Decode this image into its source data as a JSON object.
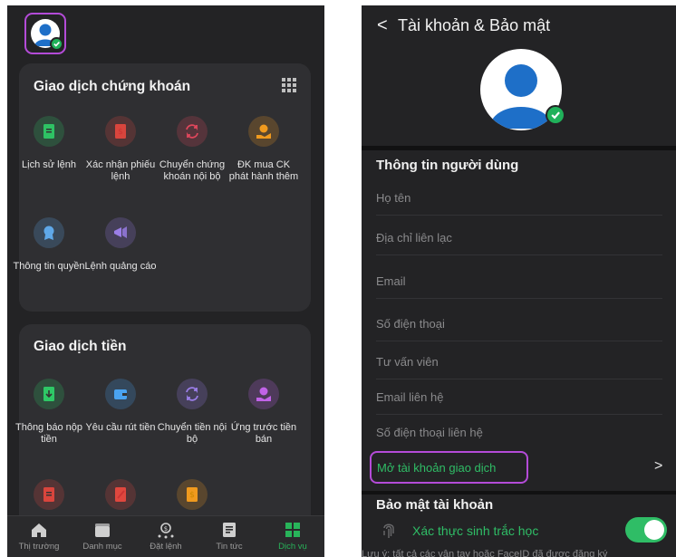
{
  "left": {
    "stock_section": {
      "title": "Giao dịch chứng khoán",
      "items": [
        {
          "label": "Lịch sử lệnh",
          "icon": "document-icon",
          "color": "#2ec866"
        },
        {
          "label": "Xác nhận phiếu lệnh",
          "icon": "receipt-icon",
          "color": "#e0473e"
        },
        {
          "label": "Chuyển chứng khoán nội bộ",
          "icon": "transfer-icon",
          "color": "#e0475c"
        },
        {
          "label": "ĐK mua CK phát hành thêm",
          "icon": "coin-hand-icon",
          "color": "#f09a1e"
        },
        {
          "label": "Thông tin quyền",
          "icon": "badge-icon",
          "color": "#5fa8e8"
        },
        {
          "label": "Lệnh quảng cáo",
          "icon": "megaphone-icon",
          "color": "#9b7ee8"
        }
      ]
    },
    "cash_section": {
      "title": "Giao dịch tiền",
      "items": [
        {
          "label": "Thông báo nộp tiền",
          "icon": "deposit-icon",
          "color": "#2ec866"
        },
        {
          "label": "Yêu cầu rút tiền",
          "icon": "wallet-icon",
          "color": "#4aa3f0"
        },
        {
          "label": "Chuyển tiền nội bộ",
          "icon": "transfer-icon",
          "color": "#9b7ee8"
        },
        {
          "label": "Ứng trước tiền bán",
          "icon": "coin-hand-icon",
          "color": "#c163e8"
        }
      ],
      "partial_icons": [
        {
          "icon": "document-icon",
          "color": "#e0473e"
        },
        {
          "icon": "edit-document-icon",
          "color": "#e0473e"
        },
        {
          "icon": "dollar-document-icon",
          "color": "#f09a1e"
        }
      ]
    },
    "tabbar": [
      {
        "label": "Thị trường",
        "icon": "home-icon",
        "active": false
      },
      {
        "label": "Danh mục",
        "icon": "folder-icon",
        "active": false
      },
      {
        "label": "Đặt lệnh",
        "icon": "order-icon",
        "active": false
      },
      {
        "label": "Tin tức",
        "icon": "news-icon",
        "active": false
      },
      {
        "label": "Dịch vụ",
        "icon": "grid-icon",
        "active": true
      }
    ]
  },
  "right": {
    "header": {
      "back": "<",
      "title": "Tài khoản & Bảo mật"
    },
    "user_info": {
      "title": "Thông tin người dùng",
      "fields": [
        "Họ tên",
        "Địa chỉ liên lạc",
        "Email",
        "Số điện thoại",
        "Tư vấn viên",
        "Email liên hệ",
        "Số điện thoại liên hệ"
      ]
    },
    "open_account": {
      "label": "Mở tài khoản giao dịch",
      "chevron": ">"
    },
    "security": {
      "title": "Bảo mật tài khoản",
      "biometric_label": "Xác thực sinh trắc học",
      "biometric_enabled": true,
      "note": "Lưu ý: tất cả các vân tay hoặc FaceID đã được đăng ký"
    }
  }
}
